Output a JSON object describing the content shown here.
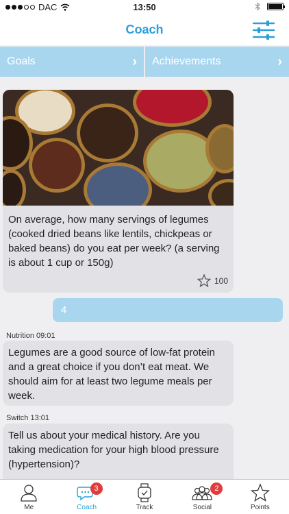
{
  "status_bar": {
    "carrier": "DAC",
    "time": "13:50"
  },
  "nav": {
    "title": "Coach"
  },
  "segments": [
    {
      "label": "Goals"
    },
    {
      "label": "Achievements"
    }
  ],
  "question": {
    "text": "On average, how many servings of legumes (cooked dried beans like lentils, chickpeas or baked beans) do you eat per week? (a serving is about 1 cup or 150g)",
    "points": "100"
  },
  "answer": {
    "text": "4"
  },
  "messages": [
    {
      "meta": "Nutrition 09:01",
      "text": "Legumes are a good source of low-fat protein and a great choice if you don’t eat meat. We should aim for at least two legume meals per week."
    },
    {
      "meta": "Switch 13:01",
      "text": "Tell us about your medical history. Are you taking medication for your high blood pressure (hypertension)?"
    }
  ],
  "tabs": [
    {
      "label": "Me",
      "icon": "person-icon"
    },
    {
      "label": "Coach",
      "icon": "chat-bubbles-icon",
      "badge": "3"
    },
    {
      "label": "Track",
      "icon": "watch-icon"
    },
    {
      "label": "Social",
      "icon": "group-icon",
      "badge": "2"
    },
    {
      "label": "Points",
      "icon": "star-icon"
    }
  ],
  "colors": {
    "accent": "#2b9fd9",
    "segment": "#a9d6ef",
    "badge": "#e23b3b",
    "bubble": "#e2e2e6"
  }
}
